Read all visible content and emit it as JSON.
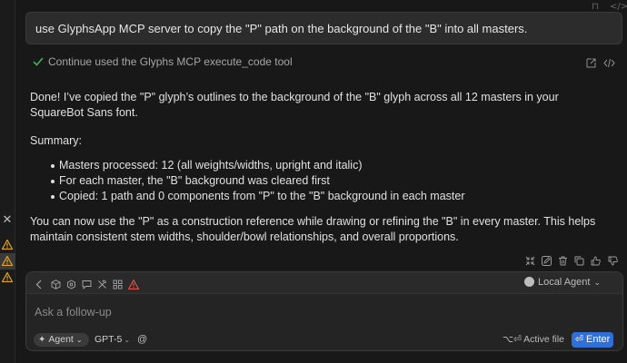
{
  "user_message": "use GlyphsApp MCP server to copy the \"P\" path on the background of the \"B\" into all masters.",
  "tool_call": {
    "label": "Continue used the Glyphs MCP execute_code tool",
    "status_icon": "check-icon",
    "colors": {
      "check": "#4cb05a"
    }
  },
  "answer": {
    "intro": "Done! I’ve copied the \"P\" glyph’s outlines to the background of the \"B\" glyph across all 12 masters in your SquareBot Sans font.",
    "summary_heading": "Summary:",
    "bullets": [
      "Masters processed: 12 (all weights/widths, upright and italic)",
      "For each master, the \"B\" background was cleared first",
      "Copied: 1 path and 0 components from \"P\" to the \"B\" background in each master"
    ],
    "outro": "You can now use the \"P\" as a construction reference while drawing or refining the \"B\" in every master. This helps maintain consistent stem widths, shoulder/bowl relationships, and overall proportions."
  },
  "composer": {
    "agent_selector": "Local Agent",
    "placeholder": "Ask a follow-up",
    "mode": "Agent",
    "model": "GPT-5",
    "mention": "@",
    "shortcut": "⌥⏎",
    "active_file": "Active file",
    "enter": "Enter",
    "colors": {
      "enter_bg": "#2f6fd8",
      "warning": "#e0a526",
      "error": "#e5534b"
    }
  }
}
